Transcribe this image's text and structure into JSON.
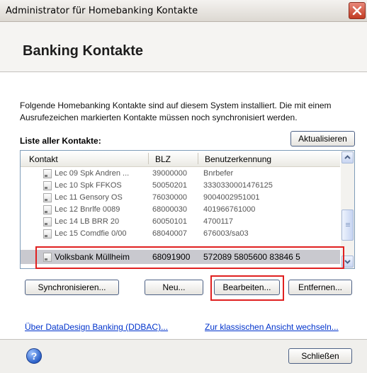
{
  "window": {
    "title": "Administrator für Homebanking Kontakte"
  },
  "header": {
    "title": "Banking Kontakte"
  },
  "description": "Folgende Homebanking Kontakte sind auf diesem System installiert. Die mit einem Ausrufezeichen markierten Kontakte müssen noch synchronisiert werden.",
  "list": {
    "label": "Liste aller Kontakte:",
    "refresh_label": "Aktualisieren",
    "columns": [
      "Kontakt",
      "BLZ",
      "Benutzerkennung"
    ],
    "rows": [
      {
        "kontakt": "Lec 09 Spk Andren ...",
        "blz": "39000000",
        "user": "Bnrbefer"
      },
      {
        "kontakt": "Lec 10 Spk FFKOS",
        "blz": "50050201",
        "user": "3330330001476125"
      },
      {
        "kontakt": "Lec 11 Gensory OS",
        "blz": "76030000",
        "user": "9004002951001"
      },
      {
        "kontakt": "Lec 12 Bnrlfe 0089",
        "blz": "68000030",
        "user": "401966761000"
      },
      {
        "kontakt": "Lec 14 LB BRR 20",
        "blz": "60050101",
        "user": "4700117"
      },
      {
        "kontakt": "Lec 15 Comdfie 0/00",
        "blz": "68040007",
        "user": "676003/sa03"
      },
      {
        "kontakt": "Volksbank Müllheim",
        "blz": "68091900",
        "user": "572089 5805600 83846 5"
      }
    ],
    "selected_index": 6
  },
  "buttons": {
    "sync": "Synchronisieren...",
    "new": "Neu...",
    "edit": "Bearbeiten...",
    "remove": "Entfernen...",
    "close": "Schließen"
  },
  "links": {
    "about": "Über DataDesign Banking (DDBAC)...",
    "classic": "Zur klassischen Ansicht wechseln..."
  },
  "icons": {
    "help": "?"
  }
}
